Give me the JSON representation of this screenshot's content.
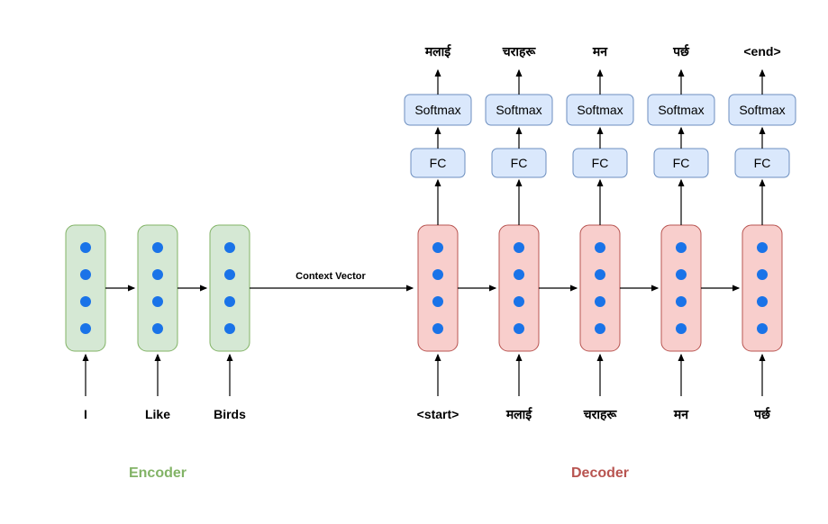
{
  "encoder": {
    "label": "Encoder",
    "color": "#82b366",
    "inputs": [
      "I",
      "Like",
      "Birds"
    ]
  },
  "context_label": "Context Vector",
  "decoder": {
    "label": "Decoder",
    "color": "#b85450",
    "inputs": [
      "<start>",
      "मलाई",
      "चराहरू",
      "मन",
      "पर्छ"
    ],
    "outputs": [
      "मलाई",
      "चराहरू",
      "मन",
      "पर्छ",
      "<end>"
    ],
    "fc_label": "FC",
    "softmax_label": "Softmax"
  }
}
